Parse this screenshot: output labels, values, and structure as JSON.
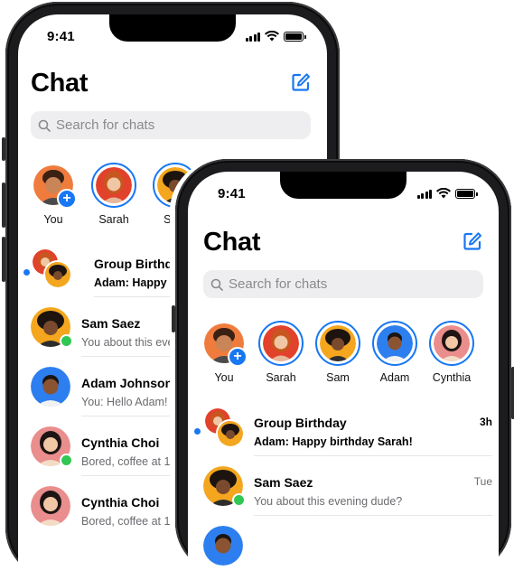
{
  "status": {
    "time": "9:41"
  },
  "header": {
    "title": "Chat"
  },
  "search": {
    "placeholder": "Search for chats"
  },
  "stories": [
    {
      "name": "You"
    },
    {
      "name": "Sarah"
    },
    {
      "name": "Sam"
    },
    {
      "name": "Adam"
    },
    {
      "name": "Cynthia"
    }
  ],
  "back_chats": [
    {
      "name": "Group Birthday",
      "message": "Adam: Happy birthday Sarah!"
    },
    {
      "name": "Sam Saez",
      "message": "You about this evening dude?"
    },
    {
      "name": "Adam Johnson",
      "message": "You: Hello Adam!"
    },
    {
      "name": "Cynthia Choi",
      "message": "Bored, coffee at 1?"
    },
    {
      "name": "Cynthia Choi",
      "message": "Bored, coffee at 1?"
    }
  ],
  "front_chats": [
    {
      "name": "Group Birthday",
      "message": "Adam: Happy birthday Sarah!",
      "time": "3h"
    },
    {
      "name": "Sam Saez",
      "message": "You about this evening dude?",
      "time": "Tue"
    }
  ],
  "colors": {
    "accent": "#1877f2",
    "online": "#31c754"
  }
}
